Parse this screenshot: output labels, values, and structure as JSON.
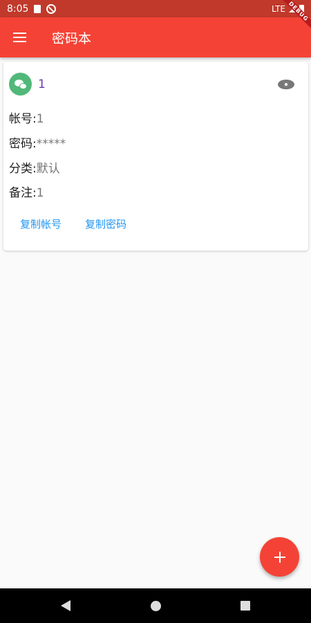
{
  "status_bar": {
    "time": "8:05",
    "network": "LTE"
  },
  "debug_banner": "DEBUG",
  "app_bar": {
    "title": "密码本",
    "menu_icon": "menu-icon"
  },
  "entry": {
    "icon": "wechat-icon",
    "icon_color": "#51b879",
    "title": "1",
    "account_label": "帐号:",
    "account_value": "1",
    "password_label": "密码:",
    "password_value": "*****",
    "category_label": "分类:",
    "category_value": "默认",
    "note_label": "备注:",
    "note_value": "1",
    "copy_account": "复制帐号",
    "copy_password": "复制密码"
  },
  "fab": {
    "icon": "plus-icon",
    "color": "#f44336"
  },
  "colors": {
    "primary": "#f44336",
    "status_bar": "#c0392b",
    "link": "#2196f3",
    "title": "#673ab7"
  }
}
